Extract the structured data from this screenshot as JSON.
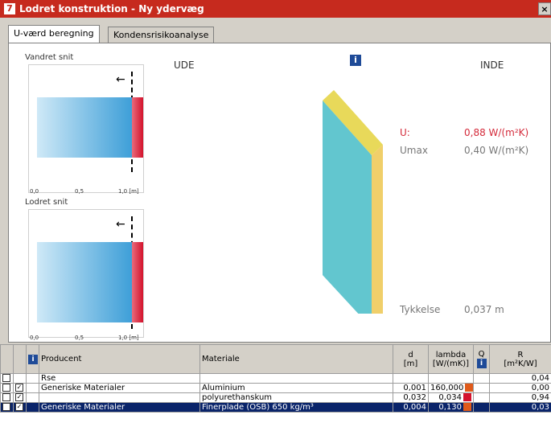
{
  "window": {
    "title": "Lodret konstruktion - Ny ydervæg",
    "close_glyph": "×"
  },
  "tabs": [
    {
      "label": "U-værd beregning"
    },
    {
      "label": "Kondensrisikoanalyse"
    }
  ],
  "diagrams": {
    "top_label": "Vandret snit",
    "bottom_label": "Lodret snit",
    "scale_labels": [
      "0,0",
      "0,5",
      "1,0 [m]"
    ]
  },
  "view": {
    "outside_label": "UDE",
    "inside_label": "INDE",
    "u_label": "U:",
    "u_value": "0,88 W/(m²K)",
    "umax_label": "Umax",
    "umax_value": "0,40 W/(m²K)",
    "thickness_label": "Tykkelse",
    "thickness_value": "0,037 m",
    "info_glyph": "i"
  },
  "colors": {
    "u_value": "#d42a3a",
    "titlebar": "#c62a1e",
    "selected_row": "#0a246a"
  },
  "table": {
    "headers": {
      "producer": "Producent",
      "material": "Materiale",
      "d": "d",
      "d_unit": "[m]",
      "lambda": "lambda",
      "lambda_unit": "[W/(mK)]",
      "q": "Q",
      "r": "R",
      "r_unit": "[m²K/W]"
    },
    "rows": [
      {
        "producer": "Rse",
        "material": "",
        "d": "",
        "lambda": "",
        "r": "0,04",
        "checked": false
      },
      {
        "producer": "Generiske Materialer",
        "material": "Aluminium",
        "d": "0,001",
        "lambda": "160,000",
        "r": "0,00",
        "checked": true
      },
      {
        "producer": "",
        "material": "polyurethanskum",
        "d": "0,032",
        "lambda": "0,034",
        "r": "0,94",
        "checked": true
      },
      {
        "producer": "Generiske Materialer",
        "material": "Finerplade (OSB) 650 kg/m³",
        "d": "0,004",
        "lambda": "0,130",
        "r": "0,03",
        "checked": true
      }
    ]
  }
}
